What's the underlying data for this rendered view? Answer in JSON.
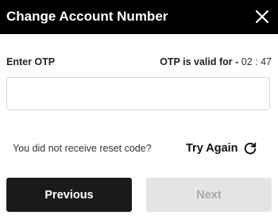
{
  "dialog": {
    "title": "Change Account Number",
    "close_icon": "close-icon"
  },
  "otp": {
    "label": "Enter OTP",
    "validity_label": "OTP is valid for - ",
    "countdown": "02 : 47",
    "input_value": "",
    "input_placeholder": ""
  },
  "resend": {
    "prompt": "You did not receive reset code?",
    "action_label": "Try Again",
    "action_icon": "refresh-icon"
  },
  "actions": {
    "previous_label": "Previous",
    "next_label": "Next",
    "next_disabled": true
  },
  "colors": {
    "header_bg": "#000000",
    "primary_button": "#1a1a1a",
    "disabled_button": "#e4e4e4",
    "disabled_text": "#a8a8a8"
  }
}
